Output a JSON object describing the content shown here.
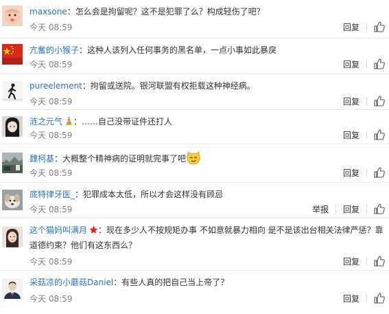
{
  "comments": [
    {
      "user": "maxsone",
      "text": "怎么会是拘留呢？这不是犯罪了么？构成轻伤了吧？",
      "time": "今天 08:59",
      "reply": "回复",
      "avatar": "baby-face-icon"
    },
    {
      "user": "亢奮的小猴子",
      "text": "这种人该列入任何事务的黑名单，一点小事如此暴戾",
      "time": "今天 08:59",
      "reply": "回复",
      "avatar": "chinese-flag-icon"
    },
    {
      "user": "pureelement",
      "text": "拘留或送院。银河联盟有权拒载这种神经病。",
      "time": "今天 08:59",
      "reply": "回复",
      "avatar": "walking-figure-icon"
    },
    {
      "user": "涟之元气",
      "text": "……自己没带证件还打人",
      "time": "今天 08:59",
      "reply": "回复",
      "avatar": "girl-portrait-icon",
      "badge": "party-hat-icon"
    },
    {
      "user": "魏柯基",
      "text": "大概整个精神病的证明就完事了吧",
      "time": "今天 08:59",
      "reply": "回复",
      "avatar": "landscape-photo-icon",
      "emoji": "smirk-emoji-icon"
    },
    {
      "user": "底特律牙医_",
      "text": "犯罪成本太低，所以才会这样没有顾忌",
      "time": "今天 08:59",
      "report": "举报",
      "reply": "回复",
      "avatar": "puppy-photo-icon"
    },
    {
      "user": "这个猫妈叫满月",
      "text": "现在多少人不按规矩办事 不如意就暴力相向 是不是该出台相关法律严惩？靠道德约束？他们有这东西么？",
      "time": "今天 08:59",
      "reply": "回复",
      "avatar": "woman-photo-icon",
      "badge": "red-star-icon"
    },
    {
      "user": "采菇凉的小蘑菇Daniel",
      "text": "有些人真的把自己当上帝了？",
      "time": "今天 08:59",
      "reply": "回复",
      "avatar": "man-suit-icon"
    }
  ],
  "colon": "：",
  "colors": {
    "username": "#2e73b8",
    "time": "#808080",
    "divider": "#e6e6e6"
  }
}
